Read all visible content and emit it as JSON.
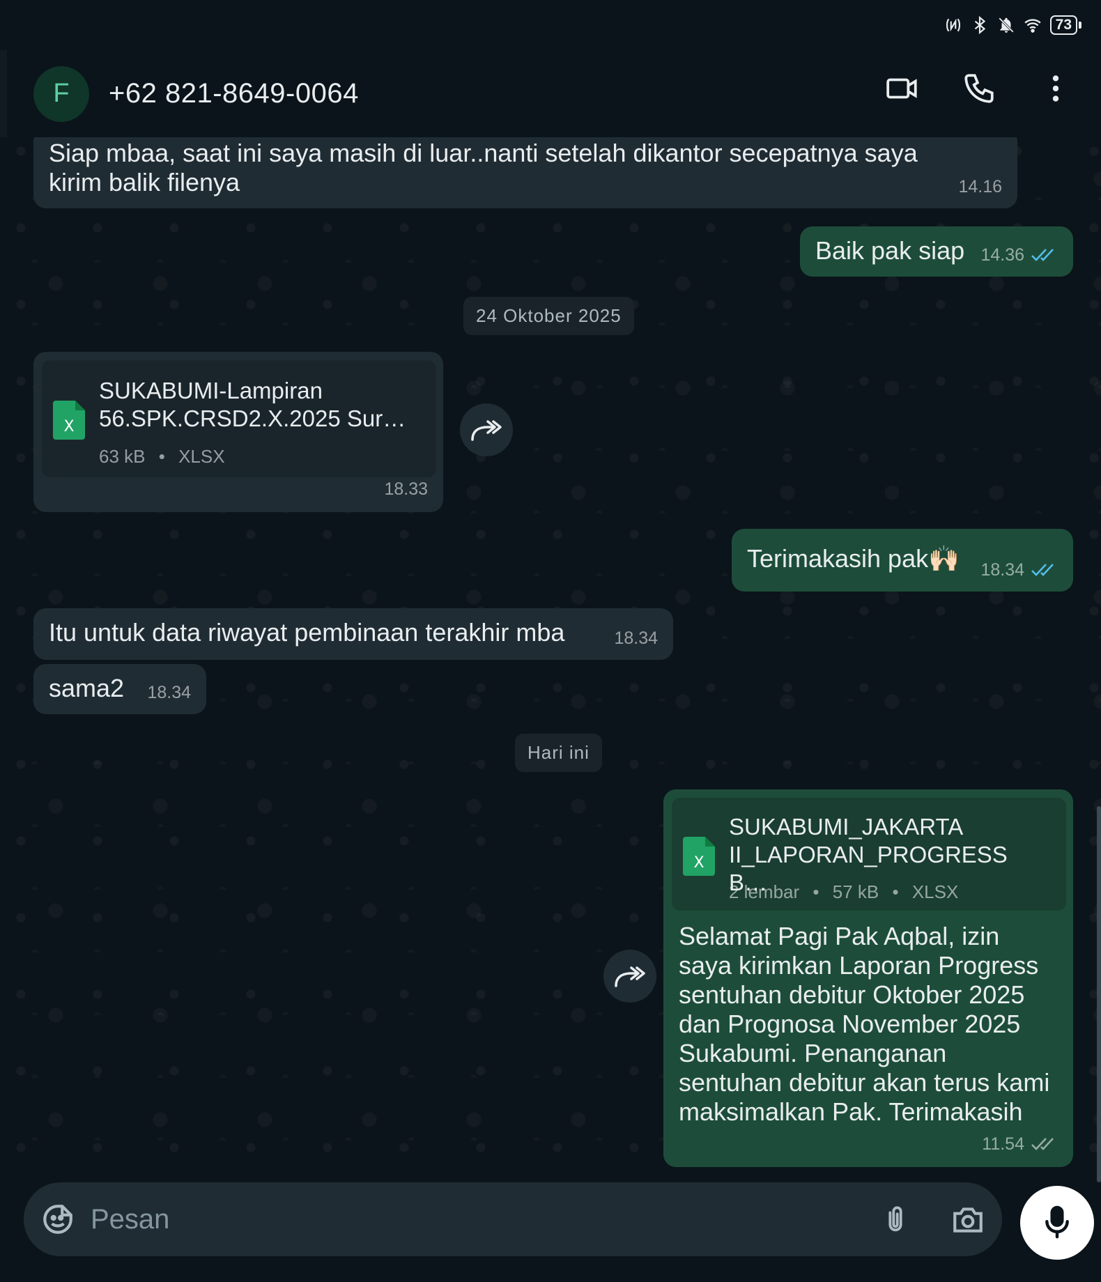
{
  "status_bar": {
    "battery": "73",
    "icons": [
      "nfc-icon",
      "bluetooth-icon",
      "bell-off-icon",
      "wifi-icon"
    ]
  },
  "header": {
    "avatar_letter": "F",
    "contact_name": "+62 821-8649-0064",
    "actions": [
      "video-call-icon",
      "voice-call-icon",
      "more-icon"
    ]
  },
  "messages": [
    {
      "direction": "in",
      "text": "Siap mbaa, saat ini saya masih di luar..nanti setelah dikantor secepatnya saya kirim balik filenya",
      "time": "14.16"
    },
    {
      "direction": "out",
      "text": "Baik pak siap",
      "time": "14.36",
      "status": "read"
    },
    {
      "type": "date",
      "text": "24 Oktober 2025"
    },
    {
      "direction": "in",
      "type": "file",
      "file_name": "SUKABUMI-Lampiran 56.SPK.CRSD2.X.2025 Sur…",
      "file_size": "63 kB",
      "file_type": "XLSX",
      "time": "18.33"
    },
    {
      "direction": "out",
      "text": "Terimakasih pak🙌🏻",
      "time": "18.34",
      "status": "read"
    },
    {
      "direction": "in",
      "text": "Itu untuk data riwayat pembinaan terakhir mba",
      "time": "18.34"
    },
    {
      "direction": "in",
      "text": "sama2",
      "time": "18.34"
    },
    {
      "type": "date",
      "text": "Hari ini"
    },
    {
      "direction": "out",
      "type": "file",
      "file_name": "SUKABUMI_JAKARTA II_LAPORAN_PROGRESS B…",
      "pages": "2 lembar",
      "file_size": "57 kB",
      "file_type": "XLSX",
      "caption": "Selamat Pagi Pak Aqbal, izin saya kirimkan Laporan Progress sentuhan debitur Oktober 2025 dan Prognosa November 2025 Sukabumi. Penanganan sentuhan debitur akan terus kami maksimalkan Pak. Terimakasih",
      "time": "11.54",
      "status": "delivered"
    }
  ],
  "composer": {
    "placeholder": "Pesan"
  },
  "colors": {
    "background": "#0b141a",
    "incoming_bubble": "#202c33",
    "outgoing_bubble": "#1d4d3a",
    "read_ticks": "#53bdeb"
  }
}
